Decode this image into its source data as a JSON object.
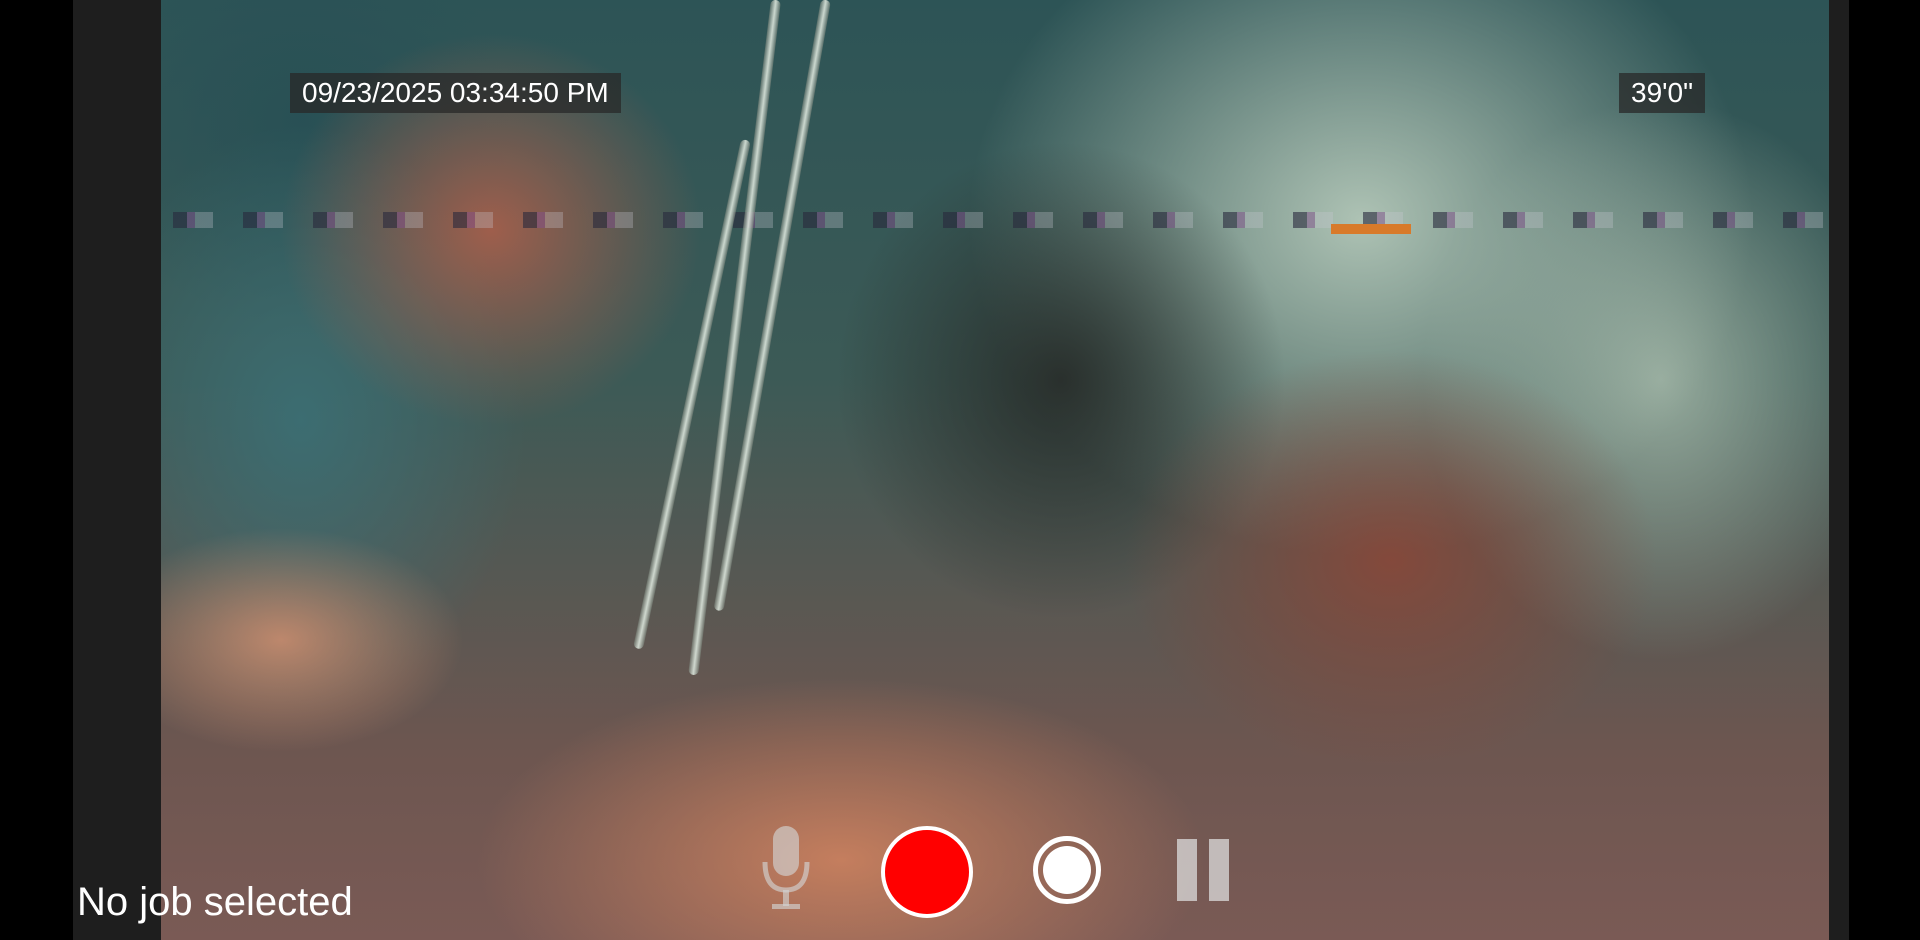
{
  "overlay": {
    "timestamp": "09/23/2025  03:34:50 PM",
    "distance": "39'0\""
  },
  "status": {
    "job_label": "No job selected"
  },
  "controls": {
    "mic_icon": "microphone-icon",
    "record_icon": "record-icon",
    "snapshot_icon": "capture-photo-icon",
    "pause_icon": "pause-icon"
  },
  "colors": {
    "record": "#ff0000",
    "overlay_bg": "#2a2a2a",
    "text": "#ffffff"
  }
}
